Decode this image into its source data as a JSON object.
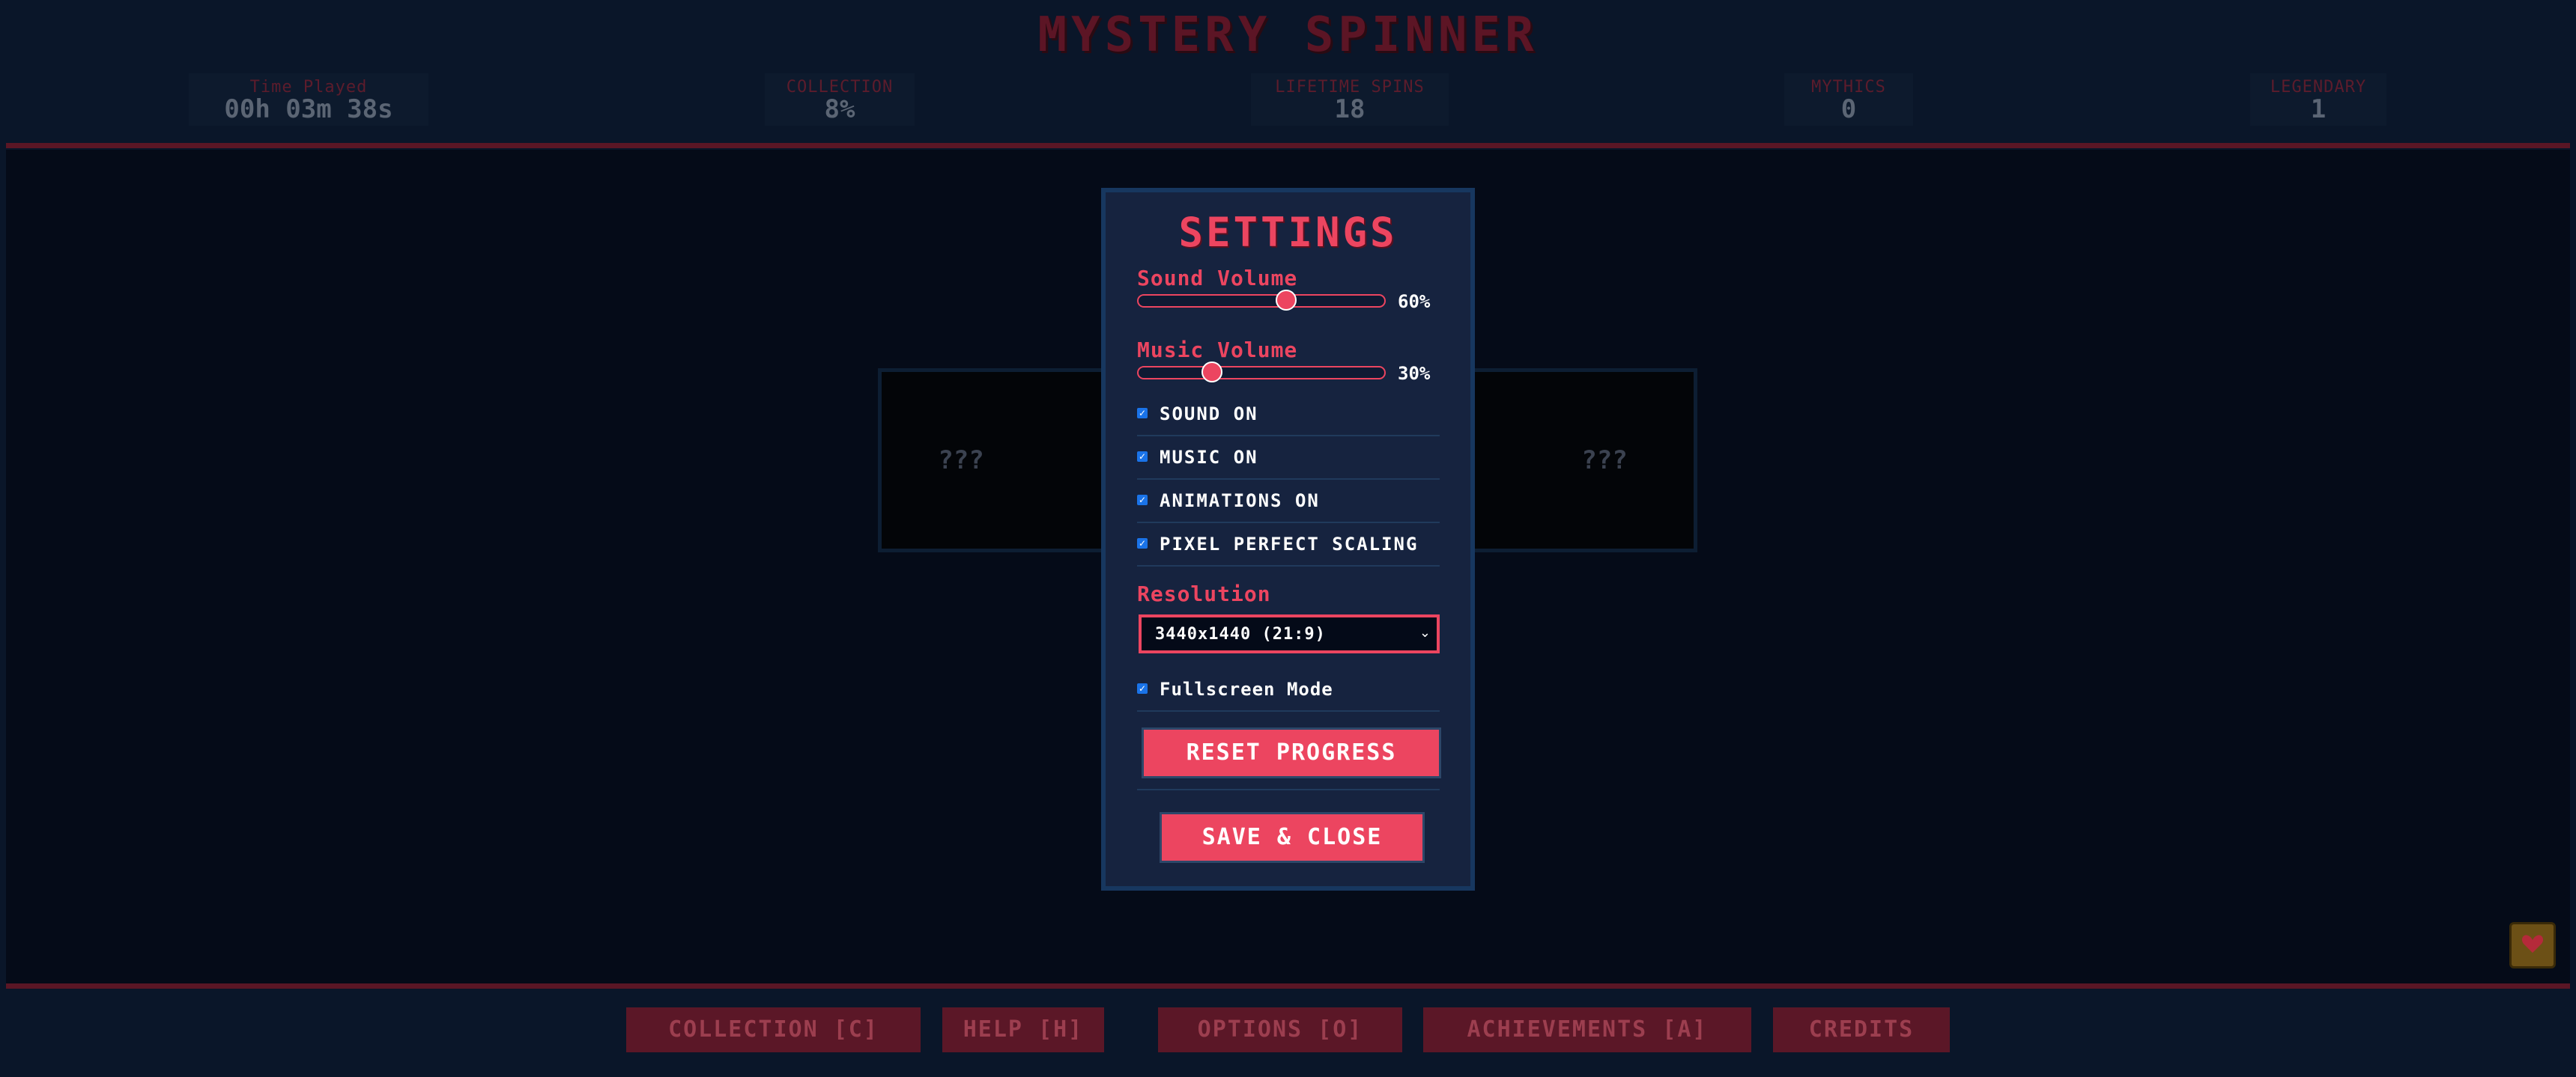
{
  "header": {
    "title": "MYSTERY SPINNER",
    "stats": [
      {
        "label": "Time Played",
        "value": "00h 03m 38s"
      },
      {
        "label": "COLLECTION",
        "value": "8%"
      },
      {
        "label": "LIFETIME SPINS",
        "value": "18"
      },
      {
        "label": "MYTHICS",
        "value": "0"
      },
      {
        "label": "LEGENDARY",
        "value": "1"
      }
    ]
  },
  "reels": [
    "???",
    "?",
    "?",
    "???"
  ],
  "settings": {
    "title": "SETTINGS",
    "sound_volume": {
      "label": "Sound Volume",
      "value": 60,
      "display": "60%"
    },
    "music_volume": {
      "label": "Music Volume",
      "value": 30,
      "display": "30%"
    },
    "options": [
      {
        "label": "SOUND ON",
        "checked": true
      },
      {
        "label": "MUSIC ON",
        "checked": true
      },
      {
        "label": "ANIMATIONS ON",
        "checked": true
      },
      {
        "label": "PIXEL PERFECT SCALING",
        "checked": true
      }
    ],
    "resolution": {
      "label": "Resolution",
      "selected": "3440x1440 (21:9)"
    },
    "fullscreen": {
      "label": "Fullscreen Mode",
      "checked": true
    },
    "reset_label": "RESET PROGRESS",
    "save_label": "SAVE & CLOSE"
  },
  "nav": [
    {
      "label": "COLLECTION [C]"
    },
    {
      "label": "HELP [H]"
    },
    {
      "label": "OPTIONS [O]"
    },
    {
      "label": "ACHIEVEMENTS [A]"
    },
    {
      "label": "CREDITS"
    }
  ],
  "colors": {
    "accent": "#ec4560",
    "modal_bg": "#16233f",
    "page_bg": "#0a1629",
    "checkbox": "#1a73e8"
  },
  "icons": {
    "corner": "heart-icon"
  }
}
